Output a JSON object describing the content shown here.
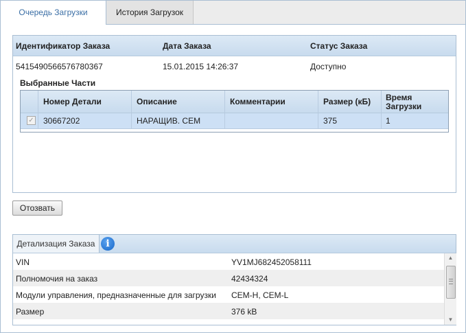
{
  "tabs": [
    {
      "label": "Очередь Загрузки",
      "active": true
    },
    {
      "label": "История Загрузок",
      "active": false
    }
  ],
  "order": {
    "headers": [
      "Идентификатор Заказа",
      "Дата Заказа",
      "Статус Заказа"
    ],
    "row": {
      "id": "5415490566576780367",
      "date": "15.01.2015 14:26:37",
      "status": "Доступно"
    }
  },
  "selected_parts": {
    "title": "Выбранные Части",
    "headers": {
      "part_number": "Номер Детали",
      "description": "Описание",
      "comments": "Комментарии",
      "size": "Размер (кБ)",
      "time_line1": "Время",
      "time_line2": "Загрузки"
    },
    "rows": [
      {
        "checked": true,
        "check_glyph": "✓",
        "part_number": "30667202",
        "description": "НАРАЩИВ. CEM",
        "comments": "",
        "size": "375",
        "time": "1"
      }
    ]
  },
  "revoke_button": "Отозвать",
  "details": {
    "tab_label": "Детализация Заказа",
    "info_glyph": "i",
    "rows": [
      {
        "label": "VIN",
        "value": "YV1MJ682452058111"
      },
      {
        "label": "Полномочия на заказ",
        "value": "42434324"
      },
      {
        "label": "Модули управления, предназначенные для загрузки",
        "value": "CEM-H, CEM-L"
      },
      {
        "label": "Размер",
        "value": "376 kB"
      }
    ],
    "scroll_up_glyph": "▲",
    "scroll_down_glyph": "▼"
  },
  "colors": {
    "accent": "#3a6ea5",
    "header_bg": "#c8dbee",
    "selected_row": "#cde0f5",
    "border": "#a9bed3",
    "info_icon": "#1667c9"
  }
}
